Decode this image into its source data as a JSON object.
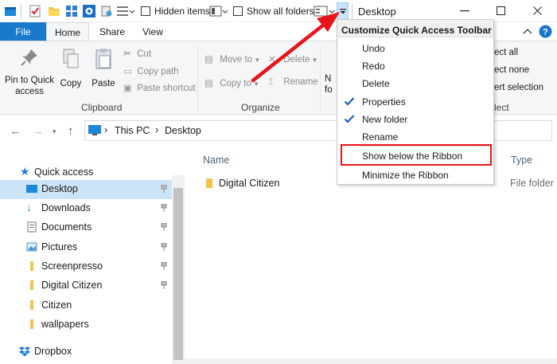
{
  "qat": {
    "hidden_items_label": "Hidden items",
    "show_all_folders_label": "Show all folders"
  },
  "window": {
    "title": "Desktop"
  },
  "ribbon_tabs": {
    "file": "File",
    "home": "Home",
    "share": "Share",
    "view": "View"
  },
  "clipboard": {
    "pin_line1": "Pin to Quick",
    "pin_line2": "access",
    "copy": "Copy",
    "paste": "Paste",
    "cut": "Cut",
    "copy_path": "Copy path",
    "paste_shortcut": "Paste shortcut",
    "group_label": "Clipboard"
  },
  "organize": {
    "move_to": "Move to",
    "copy_to": "Copy to",
    "delete": "Delete",
    "rename": "Rename",
    "group_label": "Organize"
  },
  "new_group": {
    "partial1": "N",
    "partial2": "fo"
  },
  "select_group": {
    "select_all": "ect all",
    "select_none": "ect none",
    "invert": "ert selection",
    "group_label": "lect"
  },
  "address": {
    "crumbs": [
      "This PC",
      "Desktop"
    ]
  },
  "sidebar": {
    "quick_access": "Quick access",
    "items": [
      {
        "label": "Desktop",
        "pinned": true,
        "selected": true
      },
      {
        "label": "Downloads",
        "pinned": true
      },
      {
        "label": "Documents",
        "pinned": true
      },
      {
        "label": "Pictures",
        "pinned": true
      },
      {
        "label": "Screenpresso",
        "pinned": true
      },
      {
        "label": "Digital Citizen",
        "pinned": true
      },
      {
        "label": "Citizen",
        "pinned": false
      },
      {
        "label": "wallpapers",
        "pinned": false
      }
    ],
    "dropbox": "Dropbox"
  },
  "content": {
    "columns": {
      "name": "Name",
      "type": "Type"
    },
    "rows": [
      {
        "name": "Digital Citizen",
        "type": "File folder"
      }
    ]
  },
  "menu": {
    "title": "Customize Quick Access Toolbar",
    "items": [
      {
        "label": "Undo",
        "checked": false
      },
      {
        "label": "Redo",
        "checked": false
      },
      {
        "label": "Delete",
        "checked": false
      },
      {
        "label": "Properties",
        "checked": true
      },
      {
        "label": "New folder",
        "checked": true
      },
      {
        "label": "Rename",
        "checked": false
      },
      {
        "label": "Show below the Ribbon",
        "checked": false,
        "highlighted": true
      },
      {
        "label": "Minimize the Ribbon",
        "checked": false
      }
    ]
  },
  "colors": {
    "file_tab": "#1979ca",
    "selection": "#cce4f7",
    "highlight_box": "#e8141a",
    "arrow": "#e8141a",
    "check": "#1f5fbf"
  }
}
